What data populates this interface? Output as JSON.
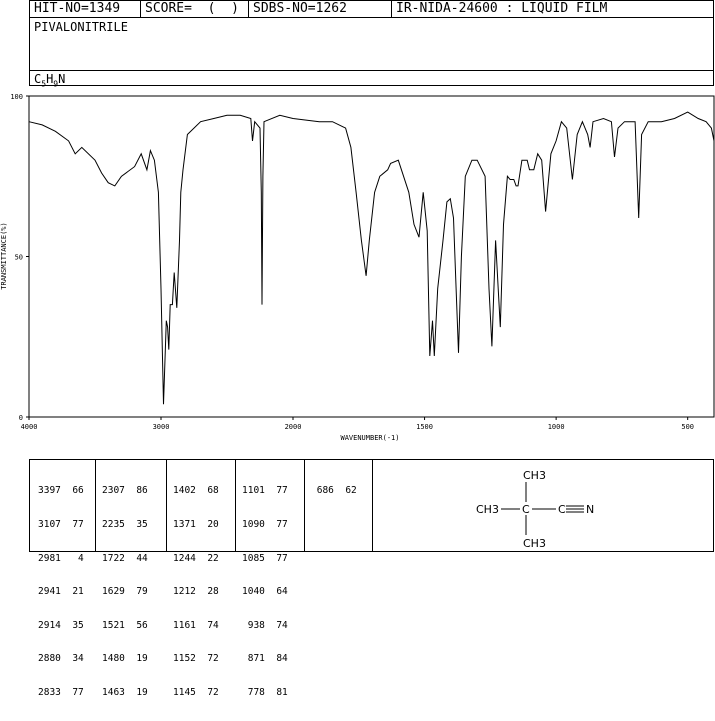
{
  "header": {
    "hit_no": "HIT-NO=1349",
    "score": "SCORE=  (  )",
    "sdbs_no": "SDBS-NO=1262",
    "ir_info": "IR-NIDA-24600 : LIQUID FILM",
    "compound_name": "PIVALONITRILE",
    "formula": {
      "c": "C",
      "c_n": "5",
      "h": "H",
      "h_n": "9",
      "n": "N"
    }
  },
  "chart_data": {
    "type": "line",
    "xlabel": "WAVENUMBER(-1)",
    "ylabel": "TRANSMITTANCE(%)",
    "xlim": [
      4000,
      400
    ],
    "ylim": [
      0,
      100
    ],
    "x_ticks": [
      "4000",
      "3000",
      "2000",
      "1500",
      "1000",
      "500"
    ],
    "y_ticks": [
      "100",
      "50",
      "0"
    ],
    "series": [
      {
        "points": [
          [
            4000,
            92
          ],
          [
            3900,
            91
          ],
          [
            3800,
            89
          ],
          [
            3700,
            86
          ],
          [
            3650,
            82
          ],
          [
            3600,
            84
          ],
          [
            3500,
            80
          ],
          [
            3450,
            76
          ],
          [
            3400,
            73
          ],
          [
            3350,
            72
          ],
          [
            3300,
            75
          ],
          [
            3200,
            78
          ],
          [
            3150,
            82
          ],
          [
            3107,
            77
          ],
          [
            3080,
            83
          ],
          [
            3050,
            80
          ],
          [
            3020,
            70
          ],
          [
            3000,
            40
          ],
          [
            2981,
            4
          ],
          [
            2960,
            30
          ],
          [
            2950,
            28
          ],
          [
            2941,
            21
          ],
          [
            2930,
            35
          ],
          [
            2914,
            35
          ],
          [
            2900,
            45
          ],
          [
            2880,
            34
          ],
          [
            2860,
            55
          ],
          [
            2850,
            70
          ],
          [
            2833,
            77
          ],
          [
            2800,
            88
          ],
          [
            2700,
            92
          ],
          [
            2600,
            93
          ],
          [
            2500,
            94
          ],
          [
            2400,
            94
          ],
          [
            2320,
            93
          ],
          [
            2307,
            86
          ],
          [
            2290,
            92
          ],
          [
            2250,
            90
          ],
          [
            2240,
            70
          ],
          [
            2235,
            35
          ],
          [
            2228,
            75
          ],
          [
            2220,
            92
          ],
          [
            2100,
            94
          ],
          [
            2000,
            93
          ],
          [
            1900,
            92
          ],
          [
            1850,
            92
          ],
          [
            1800,
            90
          ],
          [
            1780,
            84
          ],
          [
            1760,
            70
          ],
          [
            1740,
            55
          ],
          [
            1722,
            44
          ],
          [
            1710,
            55
          ],
          [
            1690,
            70
          ],
          [
            1670,
            75
          ],
          [
            1640,
            77
          ],
          [
            1629,
            79
          ],
          [
            1600,
            80
          ],
          [
            1560,
            70
          ],
          [
            1540,
            60
          ],
          [
            1521,
            56
          ],
          [
            1505,
            70
          ],
          [
            1490,
            58
          ],
          [
            1480,
            19
          ],
          [
            1470,
            30
          ],
          [
            1463,
            19
          ],
          [
            1450,
            40
          ],
          [
            1430,
            55
          ],
          [
            1415,
            67
          ],
          [
            1402,
            68
          ],
          [
            1390,
            62
          ],
          [
            1380,
            40
          ],
          [
            1371,
            20
          ],
          [
            1360,
            50
          ],
          [
            1345,
            75
          ],
          [
            1320,
            80
          ],
          [
            1300,
            80
          ],
          [
            1270,
            75
          ],
          [
            1255,
            40
          ],
          [
            1244,
            22
          ],
          [
            1230,
            55
          ],
          [
            1220,
            40
          ],
          [
            1212,
            28
          ],
          [
            1200,
            60
          ],
          [
            1185,
            75
          ],
          [
            1175,
            74
          ],
          [
            1161,
            74
          ],
          [
            1152,
            72
          ],
          [
            1145,
            72
          ],
          [
            1130,
            80
          ],
          [
            1110,
            80
          ],
          [
            1101,
            77
          ],
          [
            1090,
            77
          ],
          [
            1085,
            77
          ],
          [
            1070,
            82
          ],
          [
            1055,
            80
          ],
          [
            1040,
            64
          ],
          [
            1020,
            82
          ],
          [
            1000,
            86
          ],
          [
            980,
            92
          ],
          [
            960,
            90
          ],
          [
            938,
            74
          ],
          [
            920,
            88
          ],
          [
            900,
            92
          ],
          [
            880,
            88
          ],
          [
            871,
            84
          ],
          [
            860,
            92
          ],
          [
            820,
            93
          ],
          [
            790,
            92
          ],
          [
            778,
            81
          ],
          [
            765,
            90
          ],
          [
            740,
            92
          ],
          [
            700,
            92
          ],
          [
            686,
            62
          ],
          [
            675,
            88
          ],
          [
            650,
            92
          ],
          [
            600,
            92
          ],
          [
            550,
            93
          ],
          [
            500,
            95
          ],
          [
            460,
            93
          ],
          [
            430,
            92
          ],
          [
            410,
            90
          ],
          [
            400,
            86
          ]
        ]
      }
    ]
  },
  "peaks": {
    "columns": [
      [
        "3397  66",
        "3107  77",
        "2981   4",
        "2941  21",
        "2914  35",
        "2880  34",
        "2833  77"
      ],
      [
        "2307  86",
        "2235  35",
        "1722  44",
        "1629  79",
        "1521  56",
        "1480  19",
        "1463  19"
      ],
      [
        "1402  68",
        "1371  20",
        "1244  22",
        "1212  28",
        "1161  74",
        "1152  72",
        "1145  72"
      ],
      [
        "1101  77",
        "1090  77",
        "1085  77",
        "1040  64",
        " 938  74",
        " 871  84",
        " 778  81"
      ],
      [
        " 686  62"
      ]
    ]
  },
  "structure": {
    "top": "CH3",
    "left": "CH3",
    "center": "C",
    "right_c": "C",
    "right_n": "N",
    "bottom": "CH3"
  }
}
